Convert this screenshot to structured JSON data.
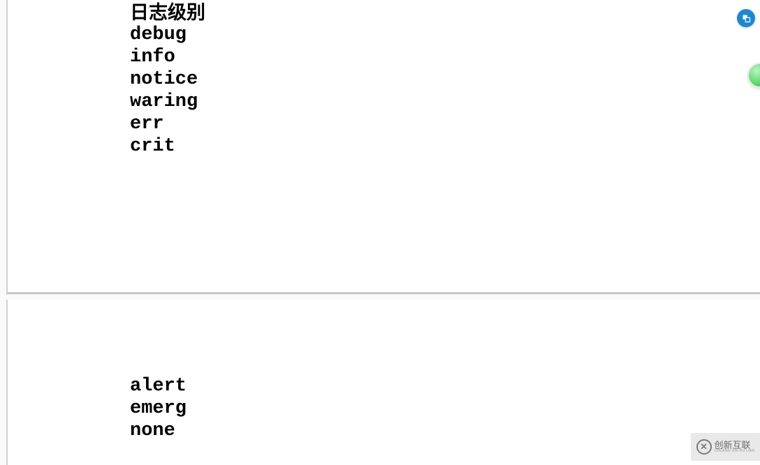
{
  "top": {
    "title": "日志级别",
    "levels": [
      "debug",
      "info",
      "notice",
      "waring",
      "err",
      "crit"
    ]
  },
  "bottom": {
    "levels": [
      "alert",
      "emerg",
      "none"
    ]
  },
  "watermark": {
    "main": "创新互联",
    "sub": "CHUANG XIN HU LIAN"
  }
}
